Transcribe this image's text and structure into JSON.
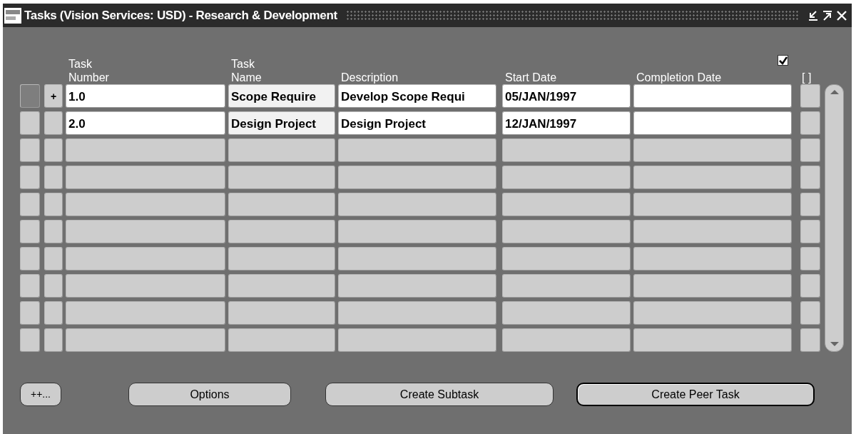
{
  "window": {
    "title": "Tasks (Vision Services: USD) - Research & Development"
  },
  "folder_checkbox": {
    "checked": true
  },
  "columns": [
    {
      "label": "Task\nNumber"
    },
    {
      "label": "Task\nName"
    },
    {
      "label": "Description"
    },
    {
      "label": "Start Date"
    },
    {
      "label": "Completion Date"
    },
    {
      "label": "[ ]"
    }
  ],
  "rows": [
    {
      "kind": "record",
      "selected": true,
      "checked": false,
      "expander": "+",
      "cells": [
        "1.0",
        "Scope Require",
        "Develop Scope Requi",
        "05/JAN/1997",
        null
      ]
    },
    {
      "kind": "record",
      "selected": false,
      "checked": false,
      "cells": [
        "2.0",
        "Design Project",
        "Design Project",
        "12/JAN/1997",
        null
      ]
    },
    {
      "kind": "empty",
      "selected": false,
      "checked": false
    },
    {
      "kind": "empty",
      "selected": false,
      "checked": false
    },
    {
      "kind": "empty",
      "selected": false,
      "checked": false
    },
    {
      "kind": "empty",
      "selected": false,
      "checked": false
    },
    {
      "kind": "empty",
      "selected": false,
      "checked": false
    },
    {
      "kind": "empty",
      "selected": false,
      "checked": false
    },
    {
      "kind": "empty",
      "selected": false,
      "checked": false
    },
    {
      "kind": "empty",
      "selected": false,
      "checked": false
    }
  ],
  "buttons": [
    {
      "label": "++...",
      "default": false
    },
    {
      "label": "Options",
      "default": false
    },
    {
      "label": "Create Subtask",
      "default": false
    },
    {
      "label": "Create Peer Task",
      "default": true
    }
  ]
}
